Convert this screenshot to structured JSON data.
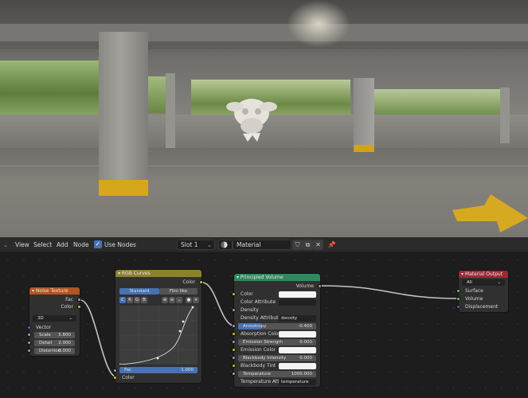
{
  "header": {
    "menu": [
      "View",
      "Select",
      "Add",
      "Node"
    ],
    "use_nodes_label": "Use Nodes",
    "slot": "Slot 1",
    "material_name": "Material"
  },
  "nodes": {
    "noise": {
      "title": "Noise Texture",
      "out_fac": "Fac",
      "out_color": "Color",
      "dimension": "3D",
      "in_vector": "Vector",
      "scale_label": "Scale",
      "scale_value": "5.600",
      "detail_label": "Detail",
      "detail_value": "2.000",
      "distortion_label": "Distortion",
      "distortion_value": "0.000"
    },
    "curves": {
      "title": "RGB Curves",
      "out_color": "Color",
      "tab_standard": "Standard",
      "tab_film": "Film like",
      "channels": [
        "C",
        "R",
        "G",
        "B"
      ],
      "fac_label": "Fac",
      "fac_value": "1.000",
      "in_color": "Color"
    },
    "volume": {
      "title": "Principled Volume",
      "out_volume": "Volume",
      "color_label": "Color",
      "color_attr_label": "Color Attribute",
      "density_label": "Density",
      "density_attr_label": "Density Attribute",
      "density_attr_value": "density",
      "anisotropy_label": "Anisotropy",
      "anisotropy_value": "-0.400",
      "absorption_label": "Absorption Color",
      "emission_strength_label": "Emission Strength",
      "emission_strength_value": "0.000",
      "emission_color_label": "Emission Color",
      "blackbody_intensity_label": "Blackbody Intensity",
      "blackbody_intensity_value": "0.000",
      "blackbody_tint_label": "Blackbody Tint",
      "temperature_label": "Temperature",
      "temperature_value": "1000.000",
      "temp_attr_label": "Temperature Att...",
      "temp_attr_value": "temperature"
    },
    "output": {
      "title": "Material Output",
      "target": "All",
      "in_surface": "Surface",
      "in_volume": "Volume",
      "in_displacement": "Displacement"
    }
  },
  "colors": {
    "noise_header": "#b4541f",
    "curves_header": "#8c8132",
    "volume_header": "#2e8a5e",
    "output_header": "#9b2a36",
    "accent_blue": "#4772b3"
  }
}
